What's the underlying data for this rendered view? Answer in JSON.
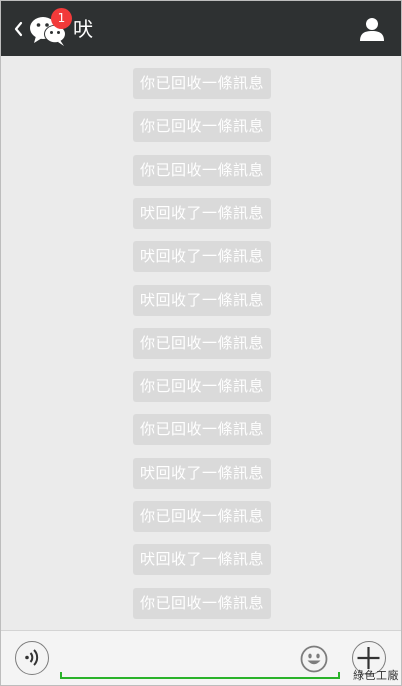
{
  "header": {
    "title": "吠",
    "unread_count": "1"
  },
  "messages": [
    {
      "text": "你已回收一條訊息"
    },
    {
      "text": "你已回收一條訊息"
    },
    {
      "text": "你已回收一條訊息"
    },
    {
      "text": "吠回收了一條訊息"
    },
    {
      "text": "吠回收了一條訊息"
    },
    {
      "text": "吠回收了一條訊息"
    },
    {
      "text": "你已回收一條訊息"
    },
    {
      "text": "你已回收一條訊息"
    },
    {
      "text": "你已回收一條訊息"
    },
    {
      "text": "吠回收了一條訊息"
    },
    {
      "text": "你已回收一條訊息"
    },
    {
      "text": "吠回收了一條訊息"
    },
    {
      "text": "你已回收一條訊息"
    }
  ],
  "input": {
    "value": ""
  },
  "watermark": "綠色工廠",
  "colors": {
    "header_bg": "#2e3132",
    "chat_bg": "#ebebeb",
    "notice_bg": "#dadada",
    "badge": "#f23a3a",
    "input_accent": "#2ab22a"
  },
  "icons": {
    "back": "chevron-left-icon",
    "chat": "wechat-bubbles-icon",
    "contact": "person-icon",
    "voice": "voice-icon",
    "emoji": "smiley-icon",
    "more": "plus-icon"
  }
}
